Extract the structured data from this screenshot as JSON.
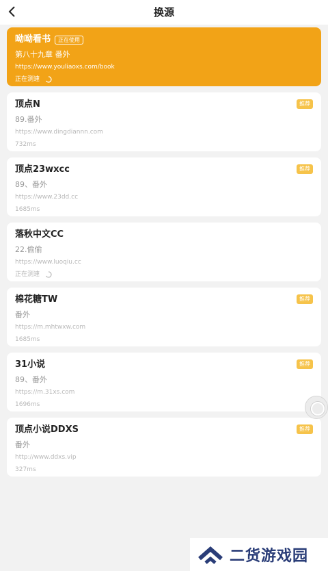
{
  "header": {
    "title": "换源"
  },
  "colors": {
    "accent": "#f2a317",
    "badge": "#f6c34a",
    "watermark": "#2a3d78"
  },
  "sources": [
    {
      "name": "呦呦看书",
      "chapter": "第八十九章 番外",
      "url": "https://www.youliaoxs.com/book",
      "speed": "正在测速",
      "using_label": "正在使用"
    },
    {
      "name": "顶点N",
      "chapter": "89.番外",
      "url": "https://www.dingdiannn.com",
      "speed": "732ms",
      "badge": "推荐"
    },
    {
      "name": "顶点23wxcc",
      "chapter": "89、番外",
      "url": "https://www.23dd.cc",
      "speed": "1685ms",
      "badge": "推荐"
    },
    {
      "name": "落秋中文CC",
      "chapter": "22.偷偷",
      "url": "https://www.luoqiu.cc",
      "speed": "正在测速"
    },
    {
      "name": "棉花糖TW",
      "chapter": "番外",
      "url": "https://m.mhtwxw.com",
      "speed": "1685ms",
      "badge": "推荐"
    },
    {
      "name": "31小说",
      "chapter": "89、番外",
      "url": "https://m.31xs.com",
      "speed": "1696ms",
      "badge": "推荐"
    },
    {
      "name": "顶点小说DDXS",
      "chapter": "番外",
      "url": "http://www.ddxs.vip",
      "speed": "327ms",
      "badge": "推荐"
    }
  ],
  "watermark": {
    "text": "二货游戏园"
  }
}
